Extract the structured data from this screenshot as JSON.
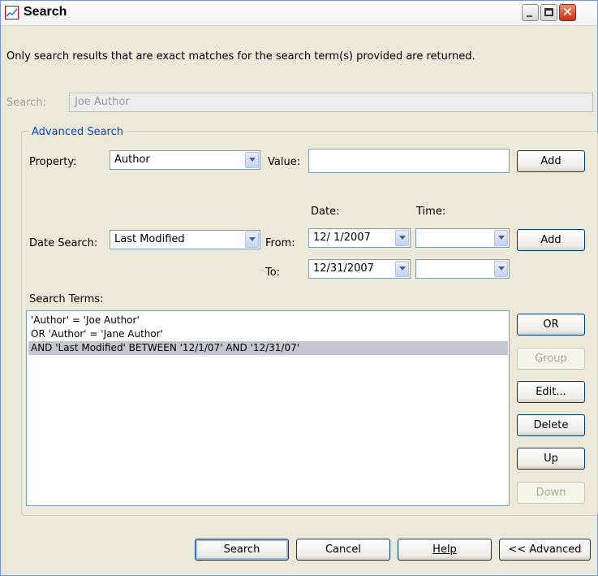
{
  "window": {
    "title": "Search"
  },
  "info_text": "Only search results that are exact matches for the search term(s) provided are returned.",
  "search": {
    "label": "Search:",
    "value": "Joe Author"
  },
  "advanced": {
    "title": "Advanced Search",
    "property_label": "Property:",
    "property_value": "Author",
    "value_label": "Value:",
    "value_value": "",
    "add_label": "Add",
    "date_col_label": "Date:",
    "time_col_label": "Time:",
    "date_search_label": "Date Search:",
    "date_search_value": "Last Modified",
    "from_label": "From:",
    "from_date": "12/ 1/2007",
    "from_time": "",
    "to_label": "To:",
    "to_date": "12/31/2007",
    "to_time": "",
    "add2_label": "Add"
  },
  "terms": {
    "label": "Search Terms:",
    "items": [
      "'Author' = 'Joe Author'",
      "OR 'Author' = 'Jane Author'",
      "AND 'Last Modified' BETWEEN '12/1/07' AND '12/31/07'"
    ],
    "selected_index": 2
  },
  "side_buttons": {
    "or": "OR",
    "group": "Group",
    "edit": "Edit...",
    "delete": "Delete",
    "up": "Up",
    "down": "Down"
  },
  "footer": {
    "search": "Search",
    "cancel": "Cancel",
    "help": "Help",
    "advanced": "<< Advanced"
  }
}
